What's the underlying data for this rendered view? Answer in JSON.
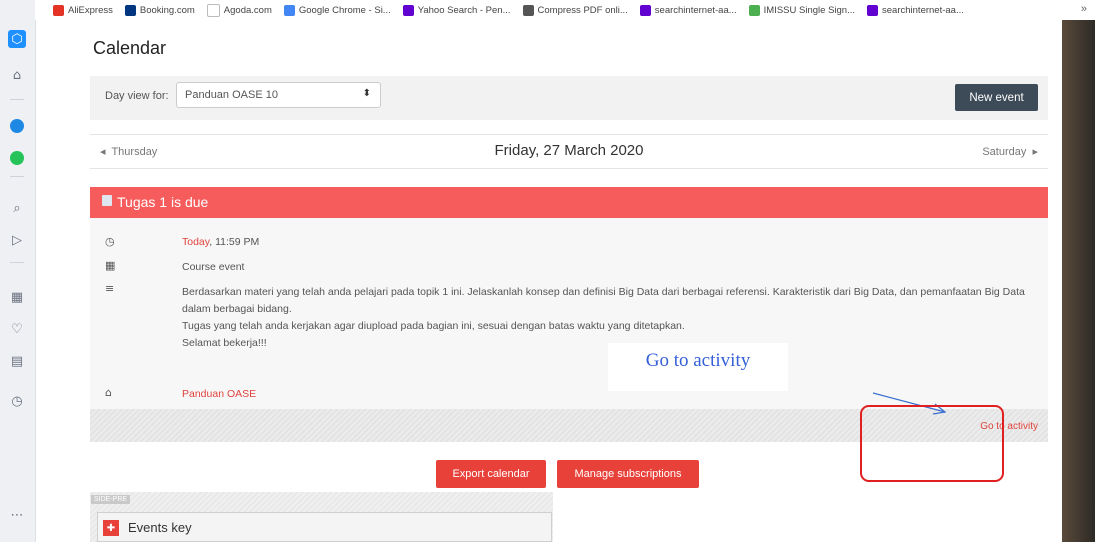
{
  "bookmarks": [
    {
      "label": "AliExpress",
      "color": "#e43225"
    },
    {
      "label": "Booking.com",
      "color": "#003580"
    },
    {
      "label": "Agoda.com",
      "color": "#ffffff"
    },
    {
      "label": "Google Chrome - Si...",
      "color": "#4285f4"
    },
    {
      "label": "Yahoo Search - Pen...",
      "color": "#6001d2"
    },
    {
      "label": "Compress PDF onli...",
      "color": "#555555"
    },
    {
      "label": "searchinternet-aa...",
      "color": "#6001d2"
    },
    {
      "label": "IMISSU Single Sign...",
      "color": "#4caf50"
    },
    {
      "label": "searchinternet-aa...",
      "color": "#6001d2"
    }
  ],
  "bookmarks_more": "»",
  "page": {
    "title": "Calendar"
  },
  "toolbar": {
    "day_view_label": "Day view for:",
    "course_select": "Panduan OASE 10",
    "new_event": "New event"
  },
  "day_nav": {
    "prev": "Thursday",
    "title": "Friday, 27 March 2020",
    "next": "Saturday"
  },
  "event": {
    "title": "Tugas 1 is due",
    "time_today": "Today",
    "time_rest": ", 11:59 PM",
    "type": "Course event",
    "description": [
      "Berdasarkan materi yang telah anda pelajari pada topik 1 ini. Jelaskanlah konsep dan definisi Big Data dari berbagai referensi. Karakteristik dari Big Data, dan pemanfaatan Big Data dalam berbagai bidang.",
      "Tugas yang telah anda kerjakan agar diupload pada bagian ini, sesuai dengan batas waktu yang ditetapkan.",
      "Selamat bekerja!!!"
    ],
    "course": "Panduan OASE",
    "go_to_activity": "Go to activity"
  },
  "annotation": {
    "label": "Go to activity",
    "arrow_color": "#3a6fd0",
    "circle_color": "#e02020"
  },
  "actions": {
    "export": "Export calendar",
    "manage": "Manage subscriptions"
  },
  "block": {
    "region_label": "SIDE-PRE",
    "events_key": "Events key"
  },
  "colors": {
    "accent": "#e8413a",
    "event_header": "#f75c5c",
    "dark_button": "#3d4a57"
  }
}
